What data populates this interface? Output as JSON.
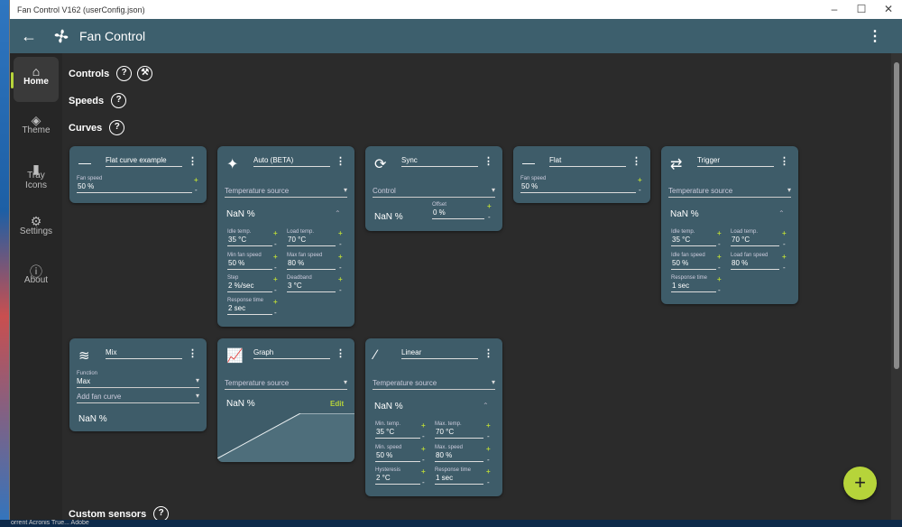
{
  "window": {
    "title": "Fan Control V162 (userConfig.json)"
  },
  "appbar": {
    "title": "Fan Control"
  },
  "sidebar": {
    "items": [
      {
        "label": "Home",
        "icon": "home-icon"
      },
      {
        "label": "Theme",
        "icon": "paint-bucket-icon"
      },
      {
        "label": "Tray\nIcons",
        "icon": "tray-icon"
      },
      {
        "label": "Settings",
        "icon": "gear-icon"
      },
      {
        "label": "About",
        "icon": "info-icon"
      }
    ]
  },
  "sections": {
    "controls": "Controls",
    "speeds": "Speeds",
    "curves": "Curves",
    "custom_sensors": "Custom sensors"
  },
  "taskbar": {
    "text": "orrent   Acronis True...   Adobe"
  },
  "curves": {
    "flat_example": {
      "name": "Flat curve example",
      "fan_speed_label": "Fan speed",
      "fan_speed": "50 %"
    },
    "auto": {
      "name": "Auto (BETA)",
      "source": "Temperature source",
      "nan": "NaN %",
      "idle_label": "Idle temp.",
      "idle": "35 °C",
      "load_label": "Load temp.",
      "load": "70 °C",
      "min_label": "Min fan speed",
      "min": "50 %",
      "max_label": "Max fan speed",
      "max": "80 %",
      "step_label": "Step",
      "step": "2 %/sec",
      "dead_label": "Deadband",
      "dead": "3 °C",
      "resp_label": "Response time",
      "resp": "2 sec"
    },
    "sync": {
      "name": "Sync",
      "control": "Control",
      "nan": "NaN %",
      "offset_label": "Offset",
      "offset": "0 %"
    },
    "flat": {
      "name": "Flat",
      "fan_speed_label": "Fan speed",
      "fan_speed": "50 %"
    },
    "trigger": {
      "name": "Trigger",
      "source": "Temperature source",
      "nan": "NaN %",
      "idle_label": "Idle temp.",
      "idle": "35 °C",
      "load_label": "Load temp.",
      "load": "70 °C",
      "idle_fan_label": "Idle fan speed",
      "idle_fan": "50 %",
      "load_fan_label": "Load fan speed",
      "load_fan": "80 %",
      "resp_label": "Response time",
      "resp": "1 sec"
    },
    "mix": {
      "name": "Mix",
      "function_label": "Function",
      "function": "Max",
      "add": "Add fan curve",
      "nan": "NaN %"
    },
    "graph": {
      "name": "Graph",
      "source": "Temperature source",
      "nan": "NaN %",
      "edit": "Edit"
    },
    "linear": {
      "name": "Linear",
      "source": "Temperature source",
      "nan": "NaN %",
      "min_t_label": "Min. temp.",
      "min_t": "35 °C",
      "max_t_label": "Max. temp.",
      "max_t": "70 °C",
      "min_s_label": "Min. speed",
      "min_s": "50 %",
      "max_s_label": "Max. speed",
      "max_s": "80 %",
      "hyst_label": "Hysteresis",
      "hyst": "2 °C",
      "resp_label": "Response time",
      "resp": "1 sec"
    }
  },
  "colors": {
    "accent": "#b6d43a",
    "card": "#3e5c69",
    "appbar": "#3d5f6d",
    "background": "#2b2b2b"
  }
}
